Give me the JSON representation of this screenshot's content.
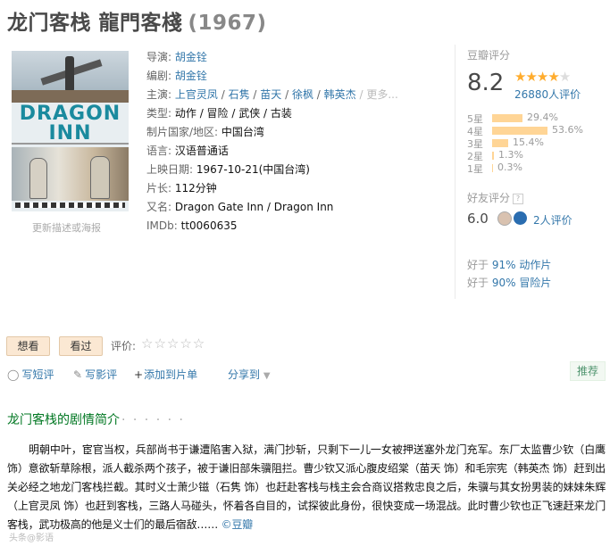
{
  "title": {
    "main": "龙门客栈 龍門客棧",
    "year": "(1967)"
  },
  "poster": {
    "logo_line1": "DRAGON",
    "logo_line2": "INN",
    "update_link": "更新描述或海报"
  },
  "info": {
    "director_label": "导演:",
    "director": "胡金铨",
    "writer_label": "编剧:",
    "writer": "胡金铨",
    "cast_label": "主演:",
    "cast": [
      "上官灵凤",
      "石隽",
      "苗天",
      "徐枫",
      "韩英杰"
    ],
    "cast_sep": " / ",
    "cast_more": " / 更多...",
    "genre_label": "类型:",
    "genre": "动作 / 冒险 / 武侠 / 古装",
    "country_label": "制片国家/地区:",
    "country": "中国台湾",
    "language_label": "语言:",
    "language": "汉语普通话",
    "release_label": "上映日期:",
    "release": "1967-10-21(中国台湾)",
    "runtime_label": "片长:",
    "runtime": "112分钟",
    "aka_label": "又名:",
    "aka": "Dragon Gate Inn / Dragon Inn",
    "imdb_label": "IMDb:",
    "imdb": "tt0060635"
  },
  "rating": {
    "title": "豆瓣评分",
    "score": "8.2",
    "stars_filled": 4,
    "stars_total": 5,
    "count": "26880人评价",
    "distribution": [
      {
        "label": "5星",
        "percent": 29.4,
        "text": "29.4%"
      },
      {
        "label": "4星",
        "percent": 53.6,
        "text": "53.6%"
      },
      {
        "label": "3星",
        "percent": 15.4,
        "text": "15.4%"
      },
      {
        "label": "2星",
        "percent": 1.3,
        "text": "1.3%"
      },
      {
        "label": "1星",
        "percent": 0.3,
        "text": "0.3%"
      }
    ],
    "friends_title": "好友评分",
    "friends_q": "?",
    "friends_score": "6.0",
    "friends_count": "2人评价",
    "compare": [
      {
        "prefix": "好于 ",
        "value": "91%",
        "genre": " 动作片"
      },
      {
        "prefix": "好于 ",
        "value": "90%",
        "genre": " 冒险片"
      }
    ]
  },
  "buttons": {
    "want": "想看",
    "seen": "看过",
    "rate_label": "评价:",
    "rate_stars": "☆☆☆☆☆"
  },
  "actions": {
    "short_review": "写短评",
    "review": "写影评",
    "add_list": "添加到片单",
    "share": "分享到",
    "recommend": "推荐"
  },
  "synopsis": {
    "title": "龙门客栈的剧情简介",
    "dots": "· · · · · ·",
    "body": "明朝中叶，宦官当权，兵部尚书于谦遭陷害入狱，满门抄斩，只剩下一儿一女被押送塞外龙门充军。东厂太监曹少钦（白鹰 饰）意欲斩草除根，派人截杀两个孩子，被于谦旧部朱骥阻拦。曹少钦又派心腹皮绍棠（苗天 饰）和毛宗宪（韩英杰 饰）赶到出关必经之地龙门客栈拦截。其时义士萧少镃（石隽 饰）也赶赴客栈与栈主会合商议搭救忠良之后，朱骥与其女扮男装的妹妹朱辉（上官灵凤 饰）也赶到客栈，三路人马碰头，怀着各自目的，试探彼此身份，很快变成一场混战。此时曹少钦也正飞速赶来龙门客栈，武功极高的他是义士们的最后宿敌……",
    "source": "©豆瓣"
  },
  "watermark": "头条@影语"
}
